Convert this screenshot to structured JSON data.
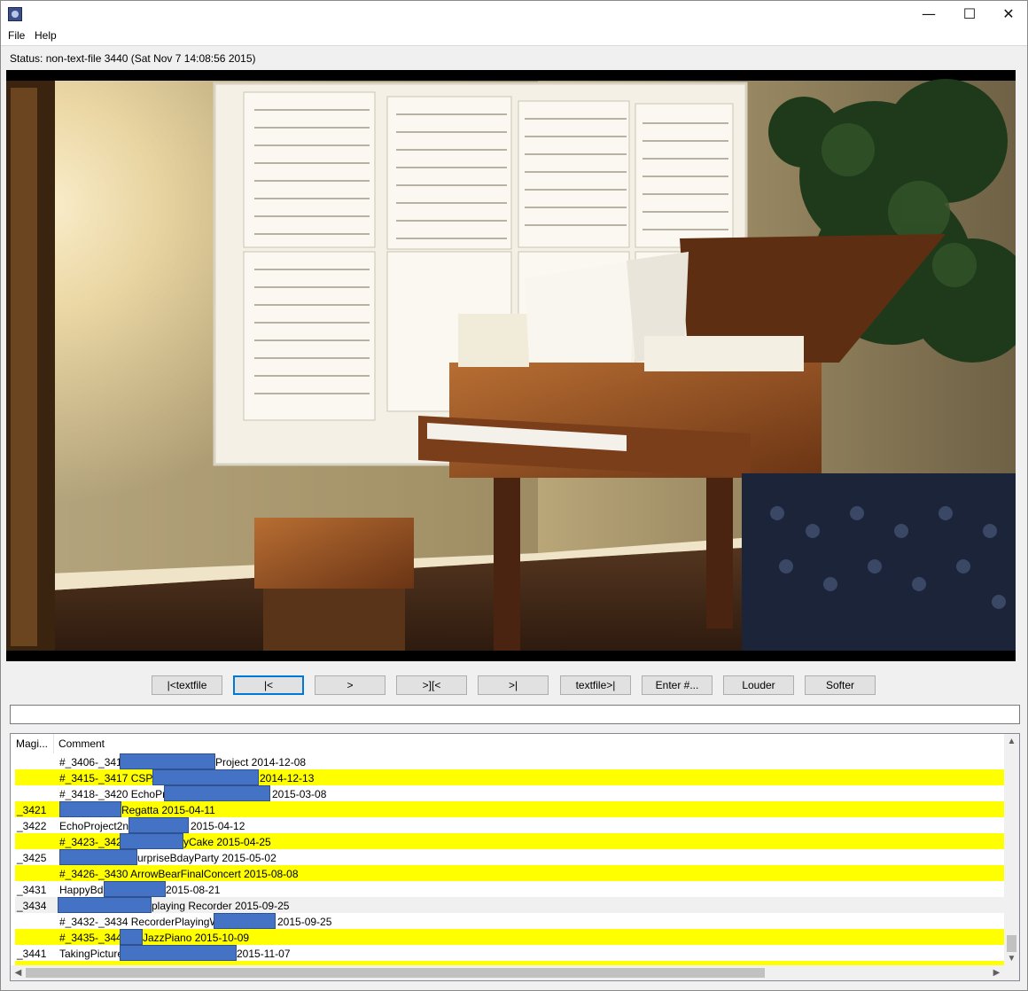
{
  "window": {
    "minimize_glyph": "—",
    "maximize_glyph": "☐",
    "close_glyph": "✕",
    "app_icon": "app-icon"
  },
  "menu": [
    "File",
    "Help"
  ],
  "status": "Status: non-text-file 3440 (Sat Nov  7 14:08:56 2015)",
  "video_frame": "living-room-grand-piano-image",
  "buttons": [
    {
      "label": "|<textfile",
      "name": "prev-textfile-button"
    },
    {
      "label": "|<",
      "name": "first-button",
      "focused": true
    },
    {
      "label": ">",
      "name": "play-button"
    },
    {
      "label": ">][<",
      "name": "step-button"
    },
    {
      "label": ">|",
      "name": "last-button"
    },
    {
      "label": "textfile>|",
      "name": "next-textfile-button"
    },
    {
      "label": "Enter #...",
      "name": "enter-number-button"
    },
    {
      "label": "Louder",
      "name": "louder-button"
    },
    {
      "label": "Softer",
      "name": "softer-button"
    }
  ],
  "command_input": "",
  "table": {
    "columns": [
      "Magi...",
      "Comment"
    ],
    "rows": [
      {
        "magic": "",
        "comment": "#_3406-_3414",
        "tail": "Project 2014-12-08",
        "style": "white"
      },
      {
        "magic": "",
        "comment": "#_3415-_3417 CSPAN",
        "tail": "2014-12-13",
        "style": "yellow"
      },
      {
        "magic": "",
        "comment": "#_3418-_3420 EchoProje",
        "tail": "2015-03-08",
        "style": "white"
      },
      {
        "magic": "_3421",
        "comment": "",
        "tail": "Regatta 2015-04-11",
        "style": "yellow"
      },
      {
        "magic": "_3422",
        "comment": "EchoProject2nd",
        "tail": "2015-04-12",
        "style": "white"
      },
      {
        "magic": "",
        "comment": "#_3423-_3424",
        "tail": "yCake 2015-04-25",
        "style": "yellow"
      },
      {
        "magic": "_3425",
        "comment": "",
        "tail": "urpriseBdayParty 2015-05-02",
        "style": "white"
      },
      {
        "magic": "",
        "comment": "#_3426-_3430 ArrowBearFinalConcert 2015-08-08",
        "tail": "",
        "style": "yellow"
      },
      {
        "magic": "_3431",
        "comment": "HappyBda",
        "tail": "2015-08-21",
        "style": "white"
      },
      {
        "magic": "_3434",
        "comment": "",
        "tail": "playing Recorder 2015-09-25",
        "style": "gray"
      },
      {
        "magic": "",
        "comment": "#_3432-_3434 RecorderPlayingWith",
        "tail": "2015-09-25",
        "style": "white"
      },
      {
        "magic": "",
        "comment": "#_3435-_3440",
        "tail": "JazzPiano 2015-10-09",
        "style": "yellow"
      },
      {
        "magic": "_3441",
        "comment": "TakingPicture",
        "tail": "2015-11-07",
        "style": "white"
      },
      {
        "magic": "",
        "comment": "",
        "tail": "",
        "style": "yellow"
      }
    ]
  },
  "colors": {
    "highlight_row": "#ffff00",
    "redaction": "#4472c4",
    "focus_border": "#0078d7"
  }
}
